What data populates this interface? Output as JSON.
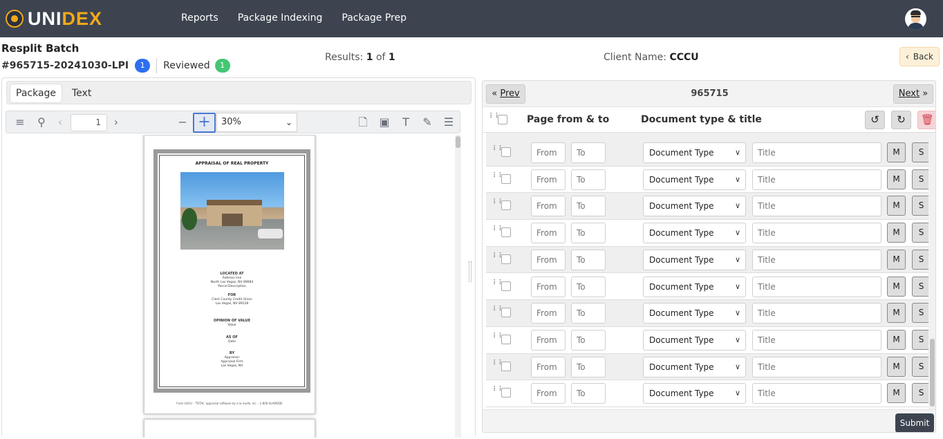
{
  "app": {
    "brand_a": "UNI",
    "brand_b": "DEX"
  },
  "nav": {
    "items": [
      "Reports",
      "Package Indexing",
      "Package Prep"
    ]
  },
  "header": {
    "title": "Resplit Batch",
    "batch_id": "#965715-20241030-LPI",
    "batch_badge": "1",
    "reviewed_label": "Reviewed",
    "reviewed_badge": "1",
    "results_label": "Results:",
    "results_current": "1",
    "results_of": "of",
    "results_total": "1",
    "client_label": "Client Name:",
    "client_name": "CCCU",
    "back_label": "Back"
  },
  "viewer": {
    "tabs": [
      "Package",
      "Text"
    ],
    "page_number": "1",
    "zoom": "30%",
    "doc": {
      "heading": "APPRAISAL OF REAL PROPERTY",
      "located_at": "LOCATED AT",
      "located_lines": [
        "Address line",
        "North Las Vegas, NV 89084",
        "Parcel Description"
      ],
      "for": "FOR",
      "for_lines": [
        "Clark County Credit Union",
        "Las Vegas, NV 89128"
      ],
      "opinion": "OPINION OF VALUE",
      "opinion_line": "Value",
      "as_of": "AS OF",
      "as_of_line": "Date",
      "by": "BY",
      "by_lines": [
        "Appraiser",
        "Appraisal Firm",
        "Las Vegas, NV"
      ],
      "footer": "Form GA1V - 'TOTAL' appraisal software by a la mode, inc. - 1-800-ALAMODE"
    }
  },
  "split": {
    "prev_label": "Prev",
    "next_label": "Next",
    "package_number": "965715",
    "col_page": "Page from & to",
    "col_doc": "Document type & title",
    "from_placeholder": "From",
    "to_placeholder": "To",
    "doc_type_label": "Document Type",
    "title_placeholder": "Title",
    "m_label": "M",
    "s_label": "S",
    "row_count": 10,
    "submit_label": "Submit"
  }
}
